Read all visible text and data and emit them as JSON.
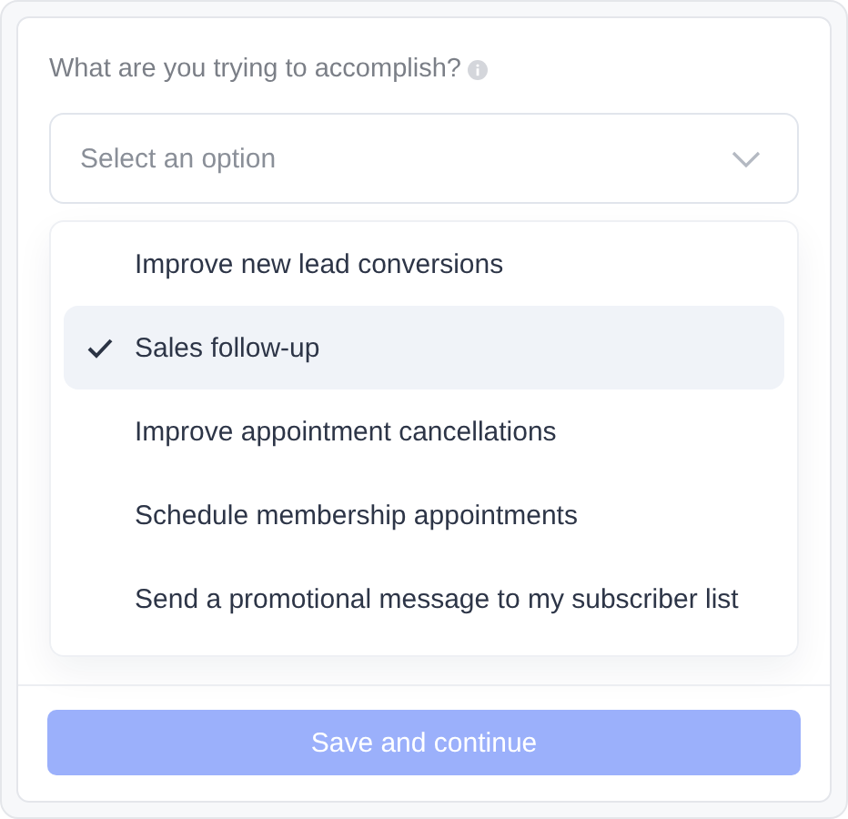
{
  "question": {
    "label": "What are you trying to accomplish?"
  },
  "select": {
    "placeholder": "Select an option"
  },
  "options": [
    {
      "label": "Improve new lead conversions",
      "selected": false
    },
    {
      "label": "Sales follow-up",
      "selected": true
    },
    {
      "label": "Improve appointment cancellations",
      "selected": false
    },
    {
      "label": "Schedule membership appointments",
      "selected": false
    },
    {
      "label": "Send a promotional message to my subscriber list",
      "selected": false
    }
  ],
  "submit": {
    "label": "Save and continue",
    "disabled": true
  }
}
